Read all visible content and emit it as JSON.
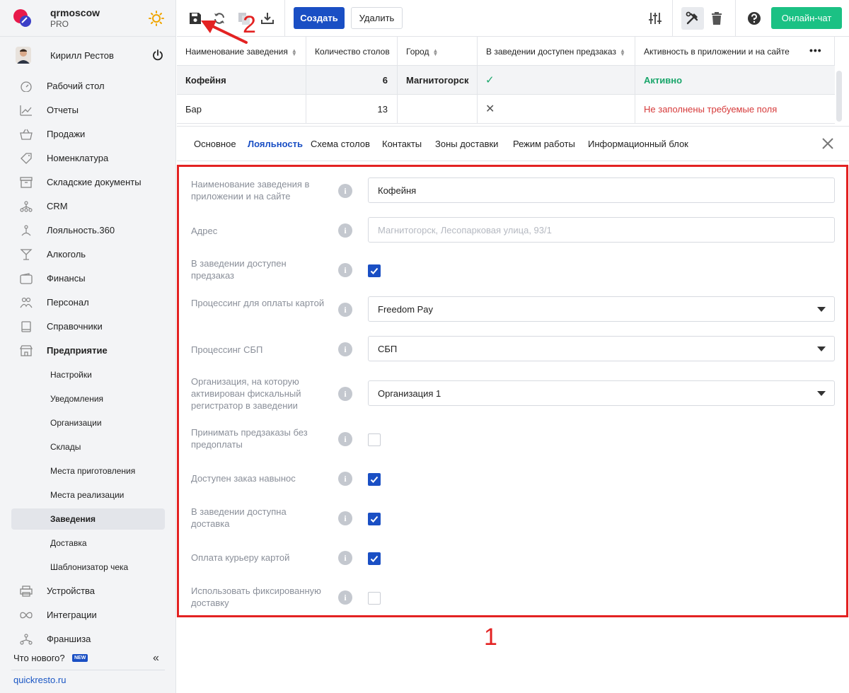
{
  "brand": {
    "name": "qrmoscow",
    "plan": "PRO"
  },
  "user": {
    "name": "Кирилл Рестов"
  },
  "sidebar": {
    "items": [
      {
        "label": "Рабочий стол",
        "icon": "dashboard-icon"
      },
      {
        "label": "Отчеты",
        "icon": "chart-icon"
      },
      {
        "label": "Продажи",
        "icon": "basket-icon"
      },
      {
        "label": "Номенклатура",
        "icon": "tag-icon"
      },
      {
        "label": "Складские документы",
        "icon": "archive-icon"
      },
      {
        "label": "CRM",
        "icon": "hierarchy-icon"
      },
      {
        "label": "Лояльность.360",
        "icon": "loyalty-icon"
      },
      {
        "label": "Алкоголь",
        "icon": "glass-icon"
      },
      {
        "label": "Финансы",
        "icon": "wallet-icon"
      },
      {
        "label": "Персонал",
        "icon": "people-icon"
      },
      {
        "label": "Справочники",
        "icon": "book-icon"
      },
      {
        "label": "Предприятие",
        "icon": "store-icon"
      }
    ],
    "subitems": [
      "Настройки",
      "Уведомления",
      "Организации",
      "Склады",
      "Места приготовления",
      "Места реализации",
      "Заведения",
      "Доставка",
      "Шаблонизатор чека"
    ],
    "bottom_items": [
      {
        "label": "Устройства",
        "icon": "printer-icon"
      },
      {
        "label": "Интеграции",
        "icon": "infinity-icon"
      },
      {
        "label": "Франшиза",
        "icon": "network-icon"
      }
    ],
    "whats_new": "Что нового?",
    "new_badge": "NEW",
    "collapse": "«",
    "link": "quickresto.ru"
  },
  "toolbar": {
    "create": "Создать",
    "delete": "Удалить",
    "chat": "Онлайн-чат"
  },
  "table": {
    "headers": [
      "Наименование заведения",
      "Количество столов",
      "Город",
      "В заведении доступен предзаказ",
      "Активность в приложении и на сайте"
    ],
    "more": "•••",
    "rows": [
      {
        "name": "Кофейня",
        "tables": "6",
        "city": "Магнитогорск",
        "preorder": "✓",
        "status": "Активно"
      },
      {
        "name": "Бар",
        "tables": "13",
        "city": "",
        "preorder": "✕",
        "status": "Не заполнены требуемые поля"
      }
    ]
  },
  "tabs": [
    "Основное",
    "Лояльность",
    "Схема столов",
    "Контакты",
    "Зоны доставки",
    "Режим работы",
    "Информационный блок"
  ],
  "form": {
    "info": "i",
    "name_label": "Наименование заведения в приложении и на сайте",
    "name_value": "Кофейня",
    "address_label": "Адрес",
    "address_placeholder": "Магнитогорск, Лесопарковая улица, 93/1",
    "preorder_label": "В заведении доступен предзаказ",
    "card_proc_label": "Процессинг для оплаты картой",
    "card_proc_value": "Freedom Pay",
    "sbp_label": "Процессинг СБП",
    "sbp_value": "СБП",
    "org_label": "Организация, на которую активирован фискальный регистратор в заведении",
    "org_value": "Организация 1",
    "noprepay_label": "Принимать предзаказы без предоплаты",
    "takeaway_label": "Доступен заказ навынос",
    "delivery_label": "В заведении доступна доставка",
    "courier_label": "Оплата курьеру картой",
    "fixed_label": "Использовать фиксированную доставку",
    "checks": {
      "preorder": true,
      "noprepay": false,
      "takeaway": true,
      "delivery": true,
      "courier": true,
      "fixed": false
    }
  },
  "annotations": {
    "one": "1",
    "two": "2"
  },
  "colors": {
    "primary": "#1a4fc4",
    "success": "#1bc184",
    "danger": "#e32222",
    "active_text": "#1aa66b",
    "error_text": "#d63a3a"
  }
}
